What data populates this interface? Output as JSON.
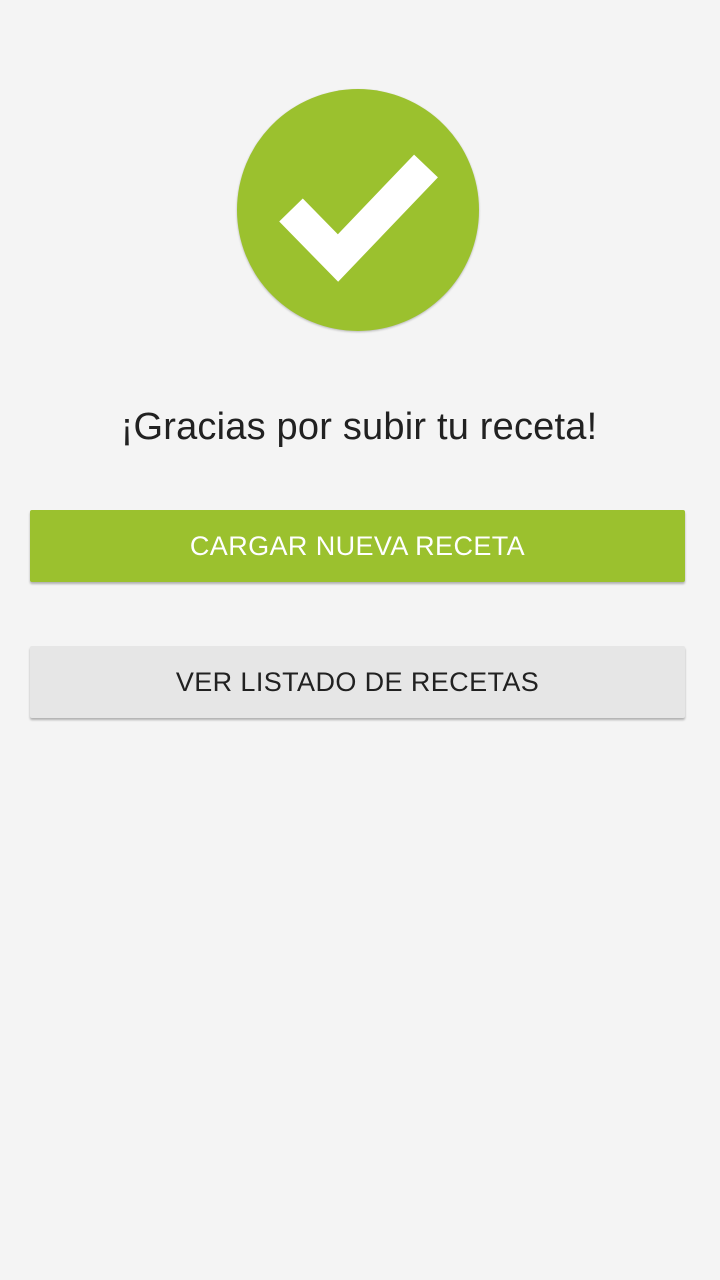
{
  "success": {
    "icon": "check-icon",
    "color": "#9bc12e"
  },
  "message": "¡Gracias por subir tu receta!",
  "buttons": {
    "upload_new": "CARGAR NUEVA RECETA",
    "view_list": "VER LISTADO DE RECETAS"
  },
  "colors": {
    "accent": "#9bc12e",
    "background": "#f4f4f4",
    "secondary_button": "#e6e6e6",
    "text": "#212121"
  }
}
